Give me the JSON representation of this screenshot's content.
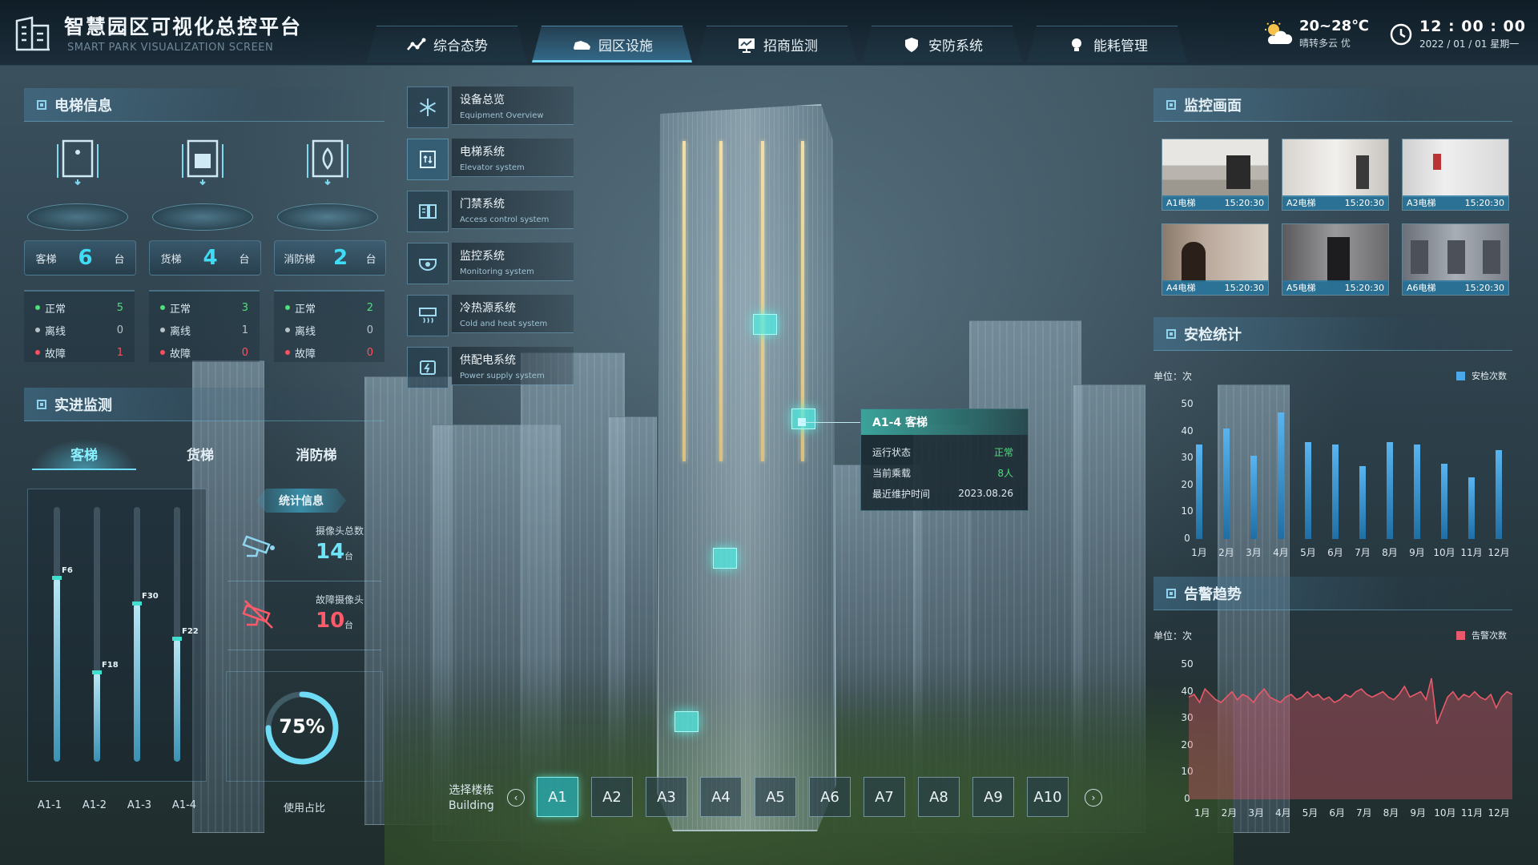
{
  "header": {
    "title": "智慧园区可视化总控平台",
    "subtitle": "SMART PARK VISUALIZATION SCREEN",
    "nav": [
      {
        "label": "综合态势",
        "icon": "trend-icon"
      },
      {
        "label": "园区设施",
        "icon": "car-icon"
      },
      {
        "label": "招商监测",
        "icon": "monitor-icon"
      },
      {
        "label": "安防系统",
        "icon": "shield-icon"
      },
      {
        "label": "能耗管理",
        "icon": "bulb-icon"
      }
    ],
    "active_nav": 1,
    "weather": {
      "temp": "20~28℃",
      "condition": "晴转多云  优"
    },
    "clock": {
      "time": "12 : 00 : 00",
      "date": "2022 / 01 / 01  星期一"
    }
  },
  "elevator_info": {
    "title": "电梯信息",
    "types": [
      {
        "label": "客梯",
        "count": "6",
        "unit": "台",
        "normal": "5",
        "offline": "0",
        "fault": "1"
      },
      {
        "label": "货梯",
        "count": "4",
        "unit": "台",
        "normal": "3",
        "offline": "1",
        "fault": "0"
      },
      {
        "label": "消防梯",
        "count": "2",
        "unit": "台",
        "normal": "2",
        "offline": "0",
        "fault": "0"
      }
    ],
    "status_labels": {
      "normal": "正常",
      "offline": "离线",
      "fault": "故障"
    },
    "colors": {
      "normal": "#4fe07a",
      "offline": "#b8c3c9",
      "fault": "#ff4f5e"
    }
  },
  "realtime": {
    "title": "实进监测",
    "tabs": [
      "客梯",
      "货梯",
      "消防梯"
    ],
    "active_tab": 0,
    "shafts": [
      {
        "label": "A1-1",
        "floor": "F6",
        "level": 0.72
      },
      {
        "label": "A1-2",
        "floor": "F18",
        "level": 0.35
      },
      {
        "label": "A1-3",
        "floor": "F30",
        "level": 0.62
      },
      {
        "label": "A1-4",
        "floor": "F22",
        "level": 0.48
      }
    ],
    "stats_badge": "统计信息",
    "camera_total": {
      "label": "摄像头总数",
      "value": "14",
      "unit": "台"
    },
    "camera_fault": {
      "label": "故障摄像头",
      "value": "10",
      "unit": "台"
    },
    "usage": {
      "value": "75%",
      "fraction": 0.75,
      "label": "使用占比"
    }
  },
  "equipment": [
    {
      "cn": "设备总览",
      "en": "Equipment Overview",
      "icon": "snowflake-icon"
    },
    {
      "cn": "电梯系统",
      "en": "Elevator system",
      "icon": "elevator-icon"
    },
    {
      "cn": "门禁系统",
      "en": "Access control system",
      "icon": "door-access-icon"
    },
    {
      "cn": "监控系统",
      "en": "Monitoring system",
      "icon": "camera-icon"
    },
    {
      "cn": "冷热源系统",
      "en": "Cold and heat  system",
      "icon": "hvac-icon"
    },
    {
      "cn": "供配电系统",
      "en": "Power supply system",
      "icon": "power-icon"
    }
  ],
  "active_equipment": 1,
  "tooltip": {
    "title": "A1-4 客梯",
    "rows": [
      {
        "label": "运行状态",
        "value": "正常"
      },
      {
        "label": "当前乘载",
        "value": "8人"
      },
      {
        "label": "最近维护时间",
        "value": "2023.08.26"
      }
    ]
  },
  "building_select": {
    "label": "选择楼栋",
    "label_en": "Building",
    "buildings": [
      "A1",
      "A2",
      "A3",
      "A4",
      "A5",
      "A6",
      "A7",
      "A8",
      "A9",
      "A10"
    ],
    "active": 0,
    "prev": "‹",
    "next": "›"
  },
  "monitor": {
    "title": "监控画面",
    "cams": [
      {
        "name": "A1电梯",
        "time": "15:20:30"
      },
      {
        "name": "A2电梯",
        "time": "15:20:30"
      },
      {
        "name": "A3电梯",
        "time": "15:20:30"
      },
      {
        "name": "A4电梯",
        "time": "15:20:30"
      },
      {
        "name": "A5电梯",
        "time": "15:20:30"
      },
      {
        "name": "A6电梯",
        "time": "15:20:30"
      }
    ]
  },
  "security_stats": {
    "title": "安检统计",
    "unit": "单位：次",
    "chart_data": {
      "type": "bar",
      "categories": [
        "1月",
        "2月",
        "3月",
        "4月",
        "5月",
        "6月",
        "7月",
        "8月",
        "9月",
        "10月",
        "11月",
        "12月"
      ],
      "series": [
        {
          "name": "安检次数",
          "values": [
            35,
            41,
            31,
            47,
            36,
            35,
            27,
            36,
            35,
            28,
            23,
            33
          ],
          "color": "#4aa8e8"
        }
      ],
      "yticks": [
        "0",
        "10",
        "20",
        "30",
        "40",
        "50"
      ],
      "ylim": [
        0,
        50
      ]
    }
  },
  "alarm_trend": {
    "title": "告警趋势",
    "unit": "单位：次",
    "chart_data": {
      "type": "area",
      "categories": [
        "1月",
        "2月",
        "3月",
        "4月",
        "5月",
        "6月",
        "7月",
        "8月",
        "9月",
        "10月",
        "11月",
        "12月"
      ],
      "series": [
        {
          "name": "告警次数",
          "color": "#e85a6a",
          "values": [
            38,
            39,
            36,
            41,
            39,
            37,
            36,
            38,
            40,
            37,
            39,
            38,
            36,
            39,
            41,
            38,
            37,
            36,
            38,
            39,
            37,
            38,
            40,
            38,
            39,
            37,
            38,
            36,
            37,
            39,
            38,
            40,
            41,
            39,
            38,
            39,
            40,
            38,
            37,
            39,
            42,
            38,
            39,
            40,
            37,
            45,
            28,
            33,
            38,
            40,
            37,
            39,
            38,
            40,
            38,
            37,
            39,
            34,
            38,
            40,
            39
          ]
        }
      ],
      "yticks": [
        "0",
        "10",
        "20",
        "30",
        "40",
        "50"
      ],
      "ylim": [
        0,
        50
      ]
    }
  }
}
